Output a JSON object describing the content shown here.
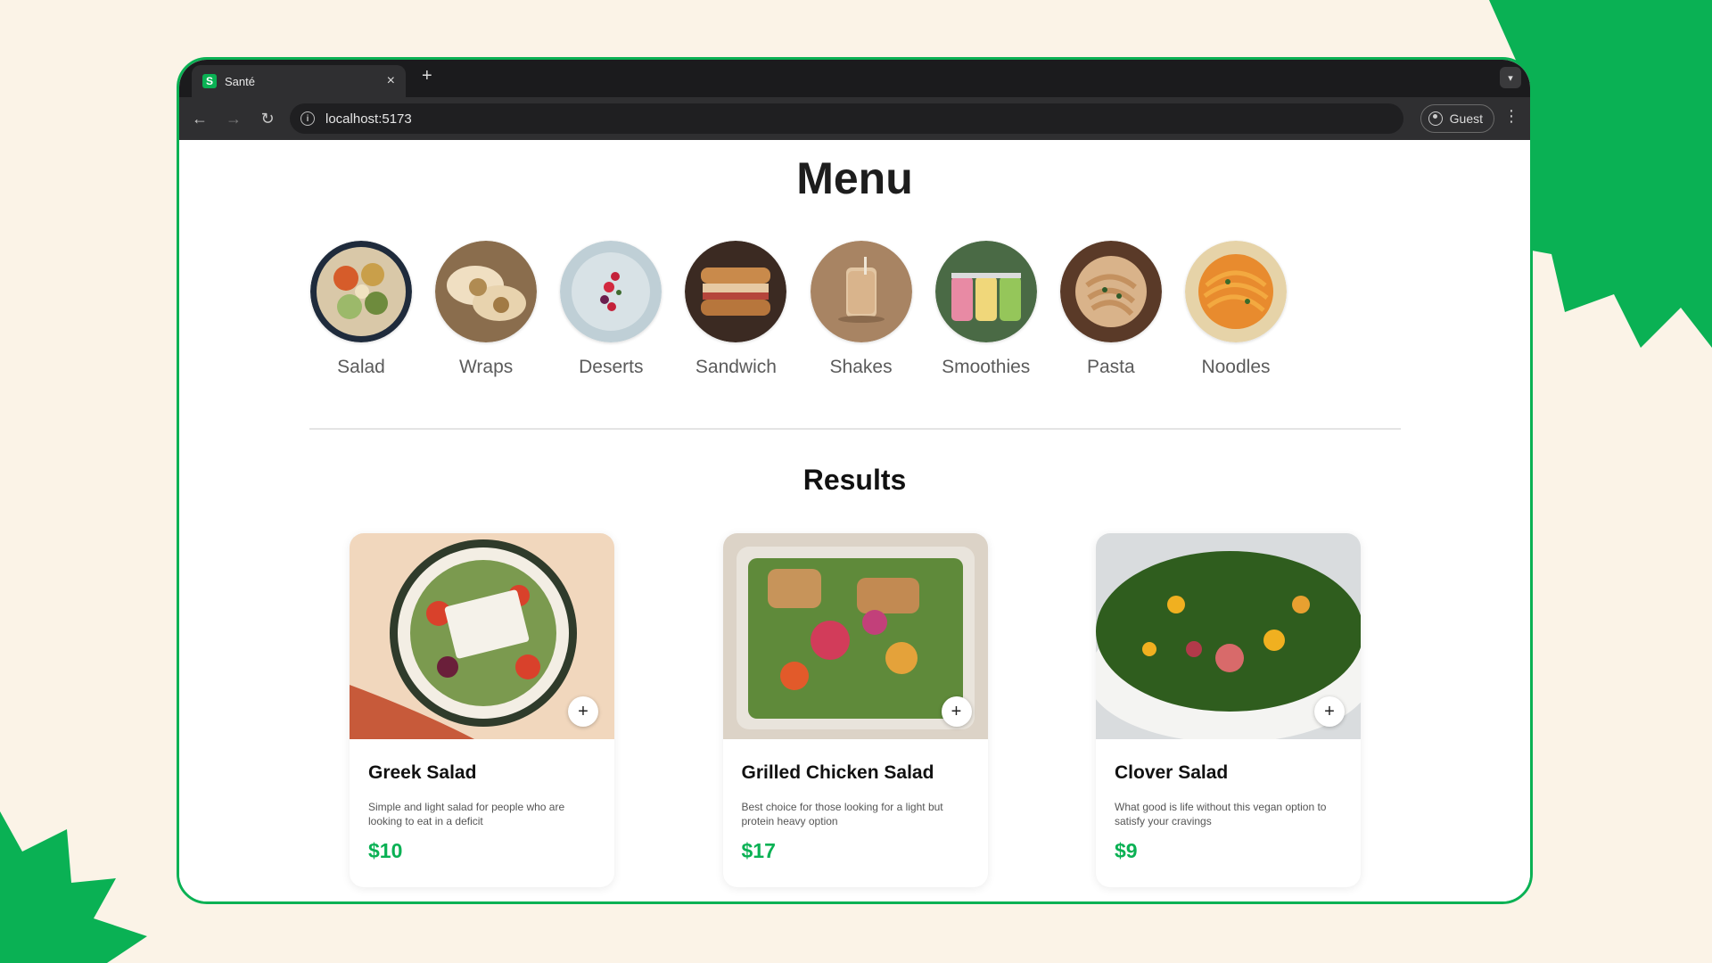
{
  "browser": {
    "tab_title": "Santé",
    "tab_favicon": "S",
    "tab_close": "×",
    "new_tab": "+",
    "url": "localhost:5173",
    "profile_label": "Guest",
    "icons": [
      "back-arrow-icon",
      "forward-arrow-icon",
      "reload-icon",
      "info-icon",
      "profile-icon",
      "kebab-menu-icon"
    ]
  },
  "page": {
    "menu_title": "Menu",
    "categories": [
      {
        "label": "Salad"
      },
      {
        "label": "Wraps"
      },
      {
        "label": "Deserts"
      },
      {
        "label": "Sandwich"
      },
      {
        "label": "Shakes"
      },
      {
        "label": "Smoothies"
      },
      {
        "label": "Pasta"
      },
      {
        "label": "Noodles"
      }
    ],
    "results_title": "Results",
    "products": [
      {
        "name": "Greek Salad",
        "description": "Simple and light salad for people who are looking to eat in a deficit",
        "price": "$10",
        "add": "+"
      },
      {
        "name": "Grilled Chicken Salad",
        "description": "Best choice for those looking for a light but protein heavy option",
        "price": "$17",
        "add": "+"
      },
      {
        "name": "Clover Salad",
        "description": "What good is life without this vegan option to satisfy your cravings",
        "price": "$9",
        "add": "+"
      }
    ]
  },
  "colors": {
    "accent": "#0ab154",
    "background": "#fbf3e7",
    "browser_dark": "#1b1b1d"
  }
}
